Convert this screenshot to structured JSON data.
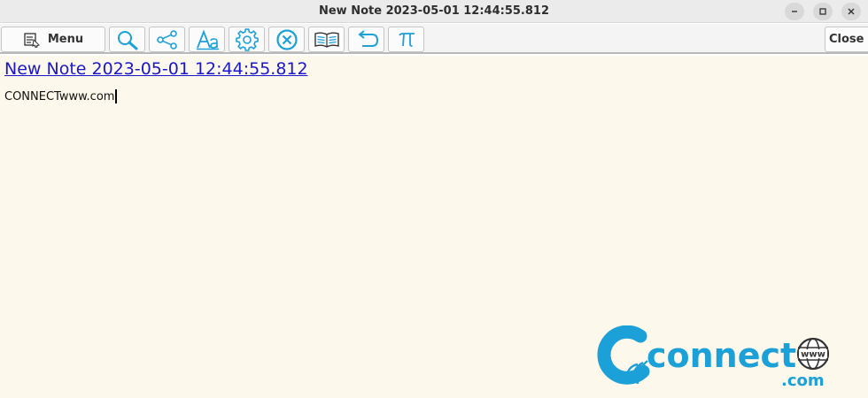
{
  "window": {
    "title": "New Note 2023-05-01 12:44:55.812",
    "buttons": [
      "minimize-icon",
      "maximize-icon",
      "close-icon"
    ]
  },
  "toolbar": {
    "menu_label": "Menu",
    "close_label": "Close",
    "icons": [
      "search-icon",
      "share-icon",
      "font-icon",
      "gear-icon",
      "delete-icon",
      "book-icon",
      "undo-icon",
      "pi-icon"
    ]
  },
  "note": {
    "title": "New Note 2023-05-01 12:44:55.812",
    "body": "CONNECTwww.com"
  },
  "watermark": {
    "text": "connect",
    "sub": ".com",
    "globe_label": "www"
  },
  "colors": {
    "accent": "#1ba0d8",
    "link": "#1a17c9",
    "paper": "#fdf8ec"
  }
}
